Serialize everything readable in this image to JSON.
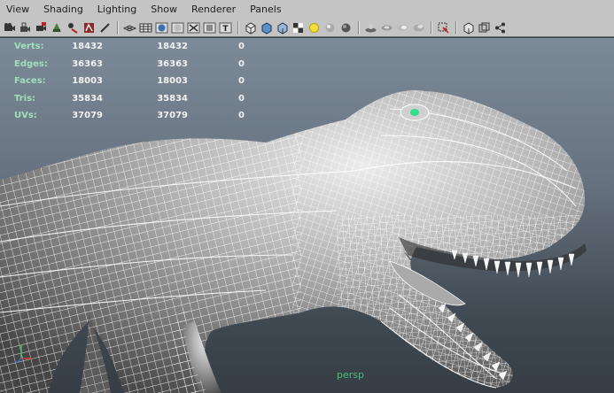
{
  "menu": {
    "items": [
      "View",
      "Shading",
      "Lighting",
      "Show",
      "Renderer",
      "Panels"
    ]
  },
  "toolbar": {
    "icons": [
      "camera-select-icon",
      "camera-lock-icon",
      "camera-attributes-icon",
      "bookmark-icon",
      "image-plane-icon",
      "two-d-pan-zoom-icon",
      "grease-pencil-icon",
      "grid-icon",
      "wireframe-shade-icon",
      "smooth-shade-icon",
      "textured-icon",
      "use-all-lights-icon",
      "shadows-icon",
      "screen-space-ao-icon",
      "motion-blur-icon",
      "multisample-icon",
      "depth-of-field-icon",
      "isolate-select-icon",
      "xray-icon",
      "xray-joints-icon",
      "backface-culling-icon",
      "resolution-gate-icon",
      "field-chart-icon",
      "safe-action-icon",
      "film-gate-icon",
      "two-pane-layout-icon",
      "four-pane-layout-icon",
      "share-icon"
    ]
  },
  "hud": {
    "rows": [
      {
        "label": "Verts:",
        "v1": "18432",
        "v2": "18432",
        "v3": "0"
      },
      {
        "label": "Edges:",
        "v1": "36363",
        "v2": "36363",
        "v3": "0"
      },
      {
        "label": "Faces:",
        "v1": "18003",
        "v2": "18003",
        "v3": "0"
      },
      {
        "label": "Tris:",
        "v1": "35834",
        "v2": "35834",
        "v3": "0"
      },
      {
        "label": "UVs:",
        "v1": "37079",
        "v2": "37079",
        "v3": "0"
      }
    ]
  },
  "viewport": {
    "camera": "persp",
    "model": "t-rex-wireframe-mesh"
  },
  "colors": {
    "menu_bg": "#c4c4c4",
    "viewport_top": "#7d8a98",
    "viewport_bottom": "#363d44",
    "hud_label": "#9fe0ba",
    "camera_label": "#4bbf78",
    "mesh_wire": "#ffffff",
    "selection_vertex": "#2fe08c"
  }
}
